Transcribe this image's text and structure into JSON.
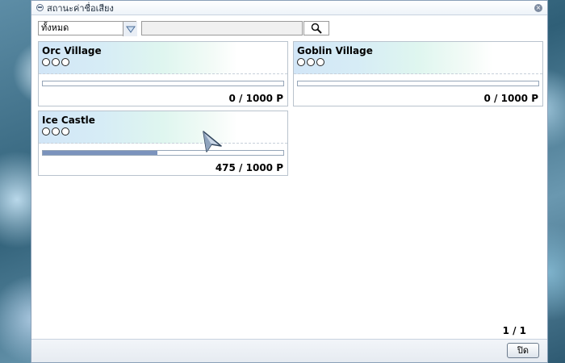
{
  "window": {
    "title": "สถานะค่าชื่อเสียง"
  },
  "filter": {
    "selected": "ทั้งหมด",
    "search_value": ""
  },
  "cards": [
    {
      "name": "Orc Village",
      "stars": 3,
      "points_text": "0 / 1000 P",
      "progress": 0
    },
    {
      "name": "Goblin Village",
      "stars": 3,
      "points_text": "0 / 1000 P",
      "progress": 0
    },
    {
      "name": "Ice Castle",
      "stars": 3,
      "points_text": "475 / 1000 P",
      "progress": 0.475
    }
  ],
  "pager": {
    "text": "1 / 1"
  },
  "footer": {
    "close_label": "ปิด"
  },
  "colors": {
    "progress_fill": "#7b93bd",
    "card_border": "#b9c3cd",
    "header_gradient_start": "#d2e6f7"
  },
  "icons": {
    "window": "minus-circle-icon",
    "close": "close-x-icon",
    "dropdown": "triangle-down-icon",
    "search": "magnifier-icon"
  }
}
